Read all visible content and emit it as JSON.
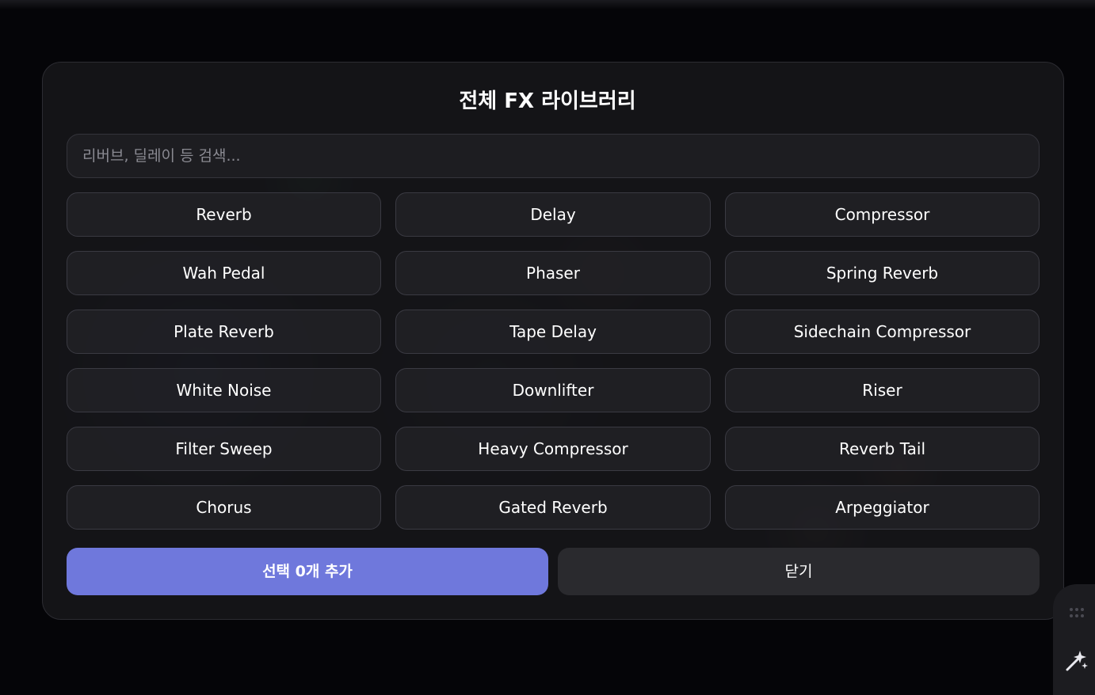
{
  "modal": {
    "title": "전체 FX 라이브러리",
    "search": {
      "placeholder": "리버브, 딜레이 등 검색..."
    },
    "fx_items": [
      "Reverb",
      "Delay",
      "Compressor",
      "Wah Pedal",
      "Phaser",
      "Spring Reverb",
      "Plate Reverb",
      "Tape Delay",
      "Sidechain Compressor",
      "White Noise",
      "Downlifter",
      "Riser",
      "Filter Sweep",
      "Heavy Compressor",
      "Reverb Tail",
      "Chorus",
      "Gated Reverb",
      "Arpeggiator"
    ],
    "add_button": "선택 0개 추가",
    "close_button": "닫기"
  },
  "dock": {
    "icons": [
      "grip-icon",
      "sparkle-icon"
    ]
  },
  "colors": {
    "accent": "#6f78dc",
    "modal_bg": "#16161a",
    "button_bg": "#2a2a2e"
  }
}
